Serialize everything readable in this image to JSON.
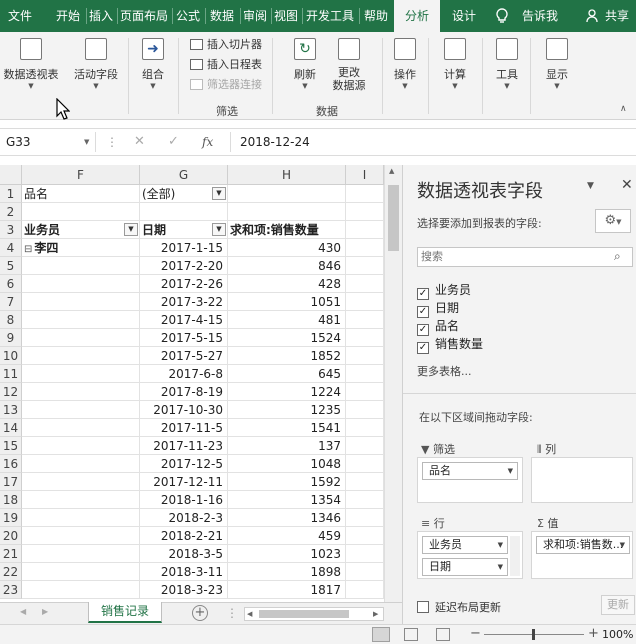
{
  "menu": {
    "tabs": [
      "文件",
      "开始",
      "插入",
      "页面布局",
      "公式",
      "数据",
      "审阅",
      "视图",
      "开发工具",
      "帮助",
      "分析",
      "设计"
    ],
    "active_tab": "分析",
    "tell_me": "告诉我",
    "share": "共享"
  },
  "ribbon": {
    "pivot_table": "数据透视表",
    "active_field": "活动字段",
    "group": "组合",
    "insert_slicer": "插入切片器",
    "insert_timeline": "插入日程表",
    "filter_connections": "筛选器连接",
    "filter_group_label": "筛选",
    "refresh": "刷新",
    "change_source": "更改\n数据源",
    "change_source_line1": "更改",
    "change_source_line2": "数据源",
    "data_group_label": "数据",
    "actions": "操作",
    "calculations": "计算",
    "tools": "工具",
    "show": "显示"
  },
  "formula_bar": {
    "name_box": "G33",
    "formula": "2018-12-24",
    "fx": "fx"
  },
  "grid": {
    "columns": [
      "F",
      "G",
      "H",
      "I"
    ],
    "row_numbers": [
      "1",
      "2",
      "3",
      "4",
      "5",
      "6",
      "7",
      "8",
      "9",
      "10",
      "11",
      "12",
      "13",
      "14",
      "15",
      "16",
      "17",
      "18",
      "19",
      "20",
      "21",
      "22",
      "23"
    ],
    "row1": {
      "label": "品名",
      "value": "(全部)"
    },
    "row3": {
      "salesperson": "业务员",
      "date": "日期",
      "sum": "求和项:销售数量"
    },
    "row4": {
      "salesperson": "李四",
      "collapse": "⊟"
    },
    "records": [
      {
        "date": "2017-1-15",
        "qty": "430"
      },
      {
        "date": "2017-2-20",
        "qty": "846"
      },
      {
        "date": "2017-2-26",
        "qty": "428"
      },
      {
        "date": "2017-3-22",
        "qty": "1051"
      },
      {
        "date": "2017-4-15",
        "qty": "481"
      },
      {
        "date": "2017-5-15",
        "qty": "1524"
      },
      {
        "date": "2017-5-27",
        "qty": "1852"
      },
      {
        "date": "2017-6-8",
        "qty": "645"
      },
      {
        "date": "2017-8-19",
        "qty": "1224"
      },
      {
        "date": "2017-10-30",
        "qty": "1235"
      },
      {
        "date": "2017-11-5",
        "qty": "1541"
      },
      {
        "date": "2017-11-23",
        "qty": "137"
      },
      {
        "date": "2017-12-5",
        "qty": "1048"
      },
      {
        "date": "2017-12-11",
        "qty": "1592"
      },
      {
        "date": "2018-1-16",
        "qty": "1354"
      },
      {
        "date": "2018-2-3",
        "qty": "1346"
      },
      {
        "date": "2018-2-21",
        "qty": "459"
      },
      {
        "date": "2018-3-5",
        "qty": "1023"
      },
      {
        "date": "2018-3-11",
        "qty": "1898"
      },
      {
        "date": "2018-3-23",
        "qty": "1817"
      }
    ]
  },
  "sheet_tab": "销售记录",
  "status": {
    "zoom": "100%"
  },
  "pane": {
    "title": "数据透视表字段",
    "subtitle": "选择要添加到报表的字段:",
    "search_placeholder": "搜索",
    "fields": [
      {
        "name": "业务员",
        "checked": true
      },
      {
        "name": "日期",
        "checked": true
      },
      {
        "name": "品名",
        "checked": true
      },
      {
        "name": "销售数量",
        "checked": true
      }
    ],
    "more_tables": "更多表格...",
    "drag_hint": "在以下区域间拖动字段:",
    "filters_label": "筛选",
    "columns_label": "列",
    "rows_label": "行",
    "values_label": "值",
    "filter_item": "品名",
    "row_items": [
      "业务员",
      "日期"
    ],
    "value_item": "求和项:销售数...",
    "defer_update": "延迟布局更新",
    "update_button": "更新"
  }
}
